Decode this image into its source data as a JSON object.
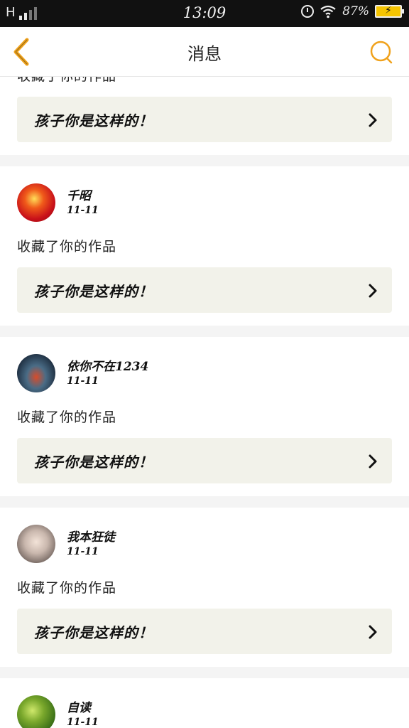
{
  "status_bar": {
    "network": "H",
    "time": "13:09",
    "battery_percent": "87%",
    "icons": [
      "signal-icon",
      "alarm-icon",
      "wifi-icon",
      "battery-charging-icon"
    ]
  },
  "header": {
    "title": "消息",
    "back_icon": "chevron-left-icon",
    "search_icon": "search-icon",
    "accent_color": "#f0a21c"
  },
  "feed": {
    "items": [
      {
        "username": "",
        "date": "",
        "action": "收藏了你的作品",
        "quote": "孩子你是这样的！"
      },
      {
        "username": "千昭",
        "date": "11-11",
        "action": "收藏了你的作品",
        "quote": "孩子你是这样的！"
      },
      {
        "username": "依你不在1234",
        "date": "11-11",
        "action": "收藏了你的作品",
        "quote": "孩子你是这样的！"
      },
      {
        "username": "我本狂徒",
        "date": "11-11",
        "action": "收藏了你的作品",
        "quote": "孩子你是这样的！"
      },
      {
        "username": "自读",
        "date": "11-11",
        "action": "",
        "quote": ""
      }
    ]
  }
}
